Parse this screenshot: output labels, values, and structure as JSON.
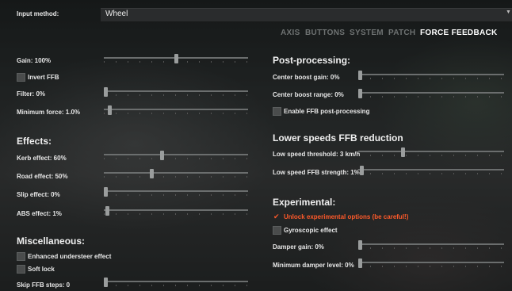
{
  "input_method": {
    "label": "Input method:",
    "value": "Wheel"
  },
  "tabs": [
    {
      "label": "AXIS",
      "active": false
    },
    {
      "label": "BUTTONS",
      "active": false
    },
    {
      "label": "SYSTEM",
      "active": false
    },
    {
      "label": "PATCH",
      "active": false
    },
    {
      "label": "FORCE FEEDBACK",
      "active": true
    }
  ],
  "left": {
    "gain": {
      "label": "Gain: 100%",
      "value_fraction": 0.5
    },
    "invert_ffb": {
      "label": "Invert FFB",
      "checked": false
    },
    "filter": {
      "label": "Filter: 0%",
      "value_fraction": 0.0
    },
    "min_force": {
      "label": "Minimum force: 1.0%",
      "value_fraction": 0.03
    },
    "effects": {
      "title": "Effects:",
      "kerb": {
        "label": "Kerb effect: 60%",
        "value_fraction": 0.4
      },
      "road": {
        "label": "Road effect: 50%",
        "value_fraction": 0.33
      },
      "slip": {
        "label": "Slip effect: 0%",
        "value_fraction": 0.0
      },
      "abs": {
        "label": "ABS effect: 1%",
        "value_fraction": 0.01
      }
    },
    "misc": {
      "title": "Miscellaneous:",
      "enhanced_understeer": {
        "label": "Enhanced understeer effect",
        "checked": false
      },
      "soft_lock": {
        "label": "Soft lock",
        "checked": false
      },
      "skip_ffb": {
        "label": "Skip FFB steps: 0",
        "value_fraction": 0.0
      }
    }
  },
  "right": {
    "post": {
      "title": "Post-processing:",
      "center_boost_gain": {
        "label": "Center boost gain: 0%",
        "value_fraction": 0.0
      },
      "center_boost_range": {
        "label": "Center boost range: 0%",
        "value_fraction": 0.0
      },
      "enable_post": {
        "label": "Enable FFB post-processing",
        "checked": false
      }
    },
    "lowspeed": {
      "title": "Lower speeds FFB reduction",
      "threshold": {
        "label": "Low speed threshold: 3 km/h",
        "value_fraction": 0.3
      },
      "strength": {
        "label": "Low speed FFB strength: 1%",
        "value_fraction": 0.01
      }
    },
    "experimental": {
      "title": "Experimental:",
      "unlock": {
        "label": "Unlock experimental options (be careful!)",
        "checked": true
      },
      "gyro": {
        "label": "Gyroscopic effect",
        "checked": false
      },
      "damper_gain": {
        "label": "Damper gain: 0%",
        "value_fraction": 0.0
      },
      "min_damper": {
        "label": "Minimum damper level: 0%",
        "value_fraction": 0.0
      }
    }
  },
  "colors": {
    "warning": "#ff5a2a",
    "active_tab": "#ffffff",
    "inactive_tab": "#6e7272"
  }
}
